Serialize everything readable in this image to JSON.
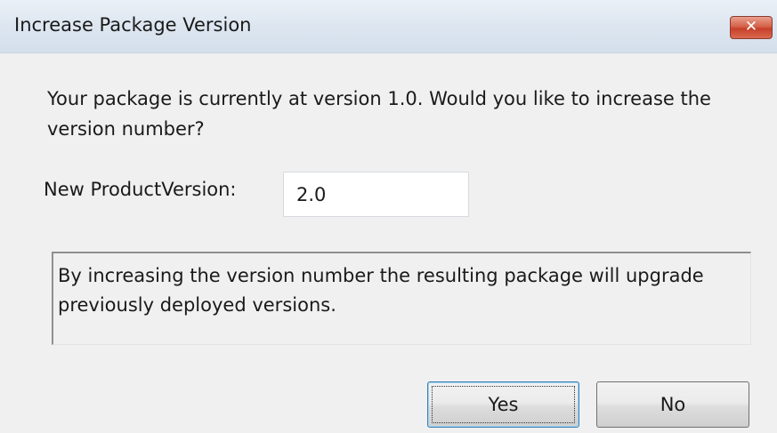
{
  "window": {
    "title": "Increase Package Version",
    "close_icon": "close-icon"
  },
  "dialog": {
    "message": "Your package is currently at version 1.0. Would you like to increase the version number?",
    "field_label": "New ProductVersion:",
    "field_value": "2.0",
    "info_text": "By increasing the version number the resulting package will upgrade previously deployed versions."
  },
  "buttons": {
    "yes_label": "Yes",
    "no_label": "No"
  },
  "colors": {
    "close_button": "#c6402a",
    "default_button_border": "#3c7fb1"
  }
}
